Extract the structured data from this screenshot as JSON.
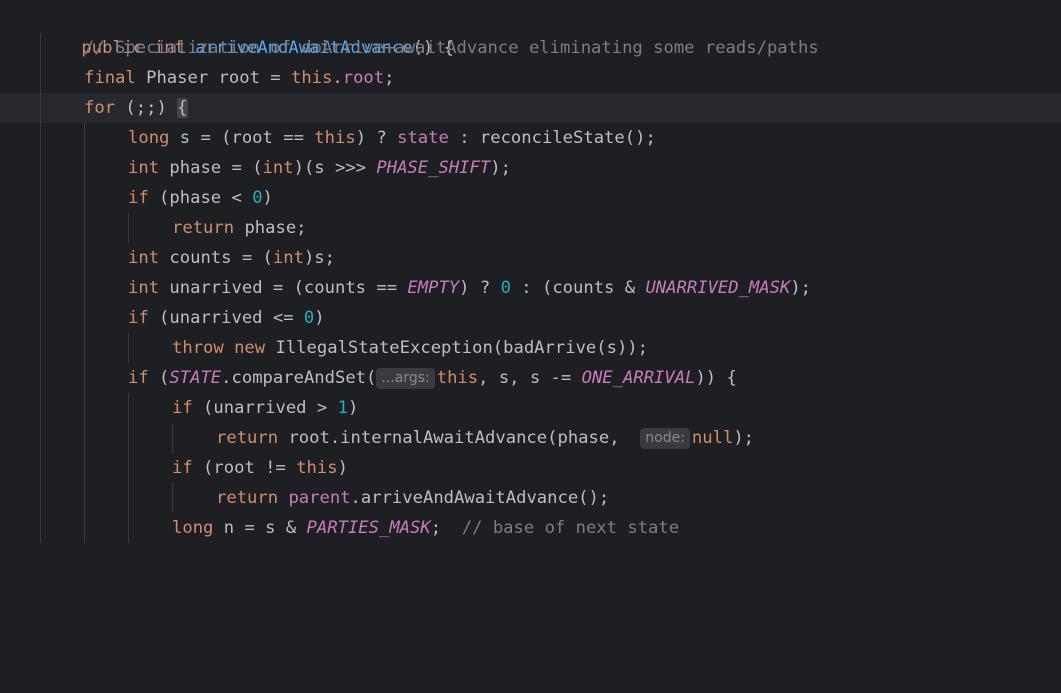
{
  "lines": [
    {
      "tokens": [
        {
          "t": "public int ",
          "c": "kw"
        },
        {
          "t": "arriveAndAwaitAdvance",
          "c": "fn"
        },
        {
          "t": "() {",
          "c": "pl"
        }
      ]
    },
    {
      "tokens": [
        {
          "t": "// Specialization of doArrive+awaitAdvance eliminating some reads/paths",
          "c": "cm"
        }
      ]
    },
    {
      "tokens": [
        {
          "t": "final ",
          "c": "kw"
        },
        {
          "t": "Phaser root = ",
          "c": "pl"
        },
        {
          "t": "this",
          "c": "kw"
        },
        {
          "t": ".",
          "c": "pl"
        },
        {
          "t": "root",
          "c": "fld"
        },
        {
          "t": ";",
          "c": "pl"
        }
      ]
    },
    {
      "tokens": [
        {
          "t": "for ",
          "c": "kw"
        },
        {
          "t": "(;;) ",
          "c": "pl"
        },
        {
          "t": "{",
          "c": "brace-hl"
        }
      ]
    },
    {
      "tokens": [
        {
          "t": "long ",
          "c": "kw"
        },
        {
          "t": "s = (root == ",
          "c": "pl"
        },
        {
          "t": "this",
          "c": "kw"
        },
        {
          "t": ") ? ",
          "c": "pl"
        },
        {
          "t": "state",
          "c": "fld"
        },
        {
          "t": " : reconcileState();",
          "c": "pl"
        }
      ]
    },
    {
      "tokens": [
        {
          "t": "int ",
          "c": "kw"
        },
        {
          "t": "phase = (",
          "c": "pl"
        },
        {
          "t": "int",
          "c": "kw"
        },
        {
          "t": ")(s >>> ",
          "c": "pl"
        },
        {
          "t": "PHASE_SHIFT",
          "c": "cst"
        },
        {
          "t": ");",
          "c": "pl"
        }
      ]
    },
    {
      "tokens": [
        {
          "t": "if ",
          "c": "kw"
        },
        {
          "t": "(phase < ",
          "c": "pl"
        },
        {
          "t": "0",
          "c": "num"
        },
        {
          "t": ")",
          "c": "pl"
        }
      ]
    },
    {
      "tokens": [
        {
          "t": "return ",
          "c": "kw"
        },
        {
          "t": "phase;",
          "c": "pl"
        }
      ]
    },
    {
      "tokens": [
        {
          "t": "int ",
          "c": "kw"
        },
        {
          "t": "counts = (",
          "c": "pl"
        },
        {
          "t": "int",
          "c": "kw"
        },
        {
          "t": ")s;",
          "c": "pl"
        }
      ]
    },
    {
      "tokens": [
        {
          "t": "int ",
          "c": "kw"
        },
        {
          "t": "unarrived = (counts == ",
          "c": "pl"
        },
        {
          "t": "EMPTY",
          "c": "cst"
        },
        {
          "t": ") ? ",
          "c": "pl"
        },
        {
          "t": "0",
          "c": "num"
        },
        {
          "t": " : (counts & ",
          "c": "pl"
        },
        {
          "t": "UNARRIVED_MASK",
          "c": "cst"
        },
        {
          "t": ");",
          "c": "pl"
        }
      ]
    },
    {
      "tokens": [
        {
          "t": "if ",
          "c": "kw"
        },
        {
          "t": "(unarrived <= ",
          "c": "pl"
        },
        {
          "t": "0",
          "c": "num"
        },
        {
          "t": ")",
          "c": "pl"
        }
      ]
    },
    {
      "tokens": [
        {
          "t": "throw new ",
          "c": "kw"
        },
        {
          "t": "IllegalStateException(badArrive(s));",
          "c": "pl"
        }
      ]
    },
    {
      "tokens": [
        {
          "t": "if ",
          "c": "kw"
        },
        {
          "t": "(",
          "c": "pl"
        },
        {
          "t": "STATE",
          "c": "cst"
        },
        {
          "t": ".compareAndSet(",
          "c": "pl"
        },
        {
          "t": "...args:",
          "c": "hint"
        },
        {
          "t": "this",
          "c": "kw"
        },
        {
          "t": ", s, s -= ",
          "c": "pl"
        },
        {
          "t": "ONE_ARRIVAL",
          "c": "cst"
        },
        {
          "t": ")) {",
          "c": "pl"
        }
      ]
    },
    {
      "tokens": [
        {
          "t": "if ",
          "c": "kw"
        },
        {
          "t": "(unarrived > ",
          "c": "pl"
        },
        {
          "t": "1",
          "c": "num"
        },
        {
          "t": ")",
          "c": "pl"
        }
      ]
    },
    {
      "tokens": [
        {
          "t": "return ",
          "c": "kw"
        },
        {
          "t": "root.internalAwaitAdvance(phase,  ",
          "c": "pl"
        },
        {
          "t": "node:",
          "c": "hint"
        },
        {
          "t": "null",
          "c": "kw"
        },
        {
          "t": ");",
          "c": "pl"
        }
      ]
    },
    {
      "tokens": [
        {
          "t": "if ",
          "c": "kw"
        },
        {
          "t": "(root != ",
          "c": "pl"
        },
        {
          "t": "this",
          "c": "kw"
        },
        {
          "t": ")",
          "c": "pl"
        }
      ]
    },
    {
      "tokens": [
        {
          "t": "return ",
          "c": "kw"
        },
        {
          "t": "parent",
          "c": "fld"
        },
        {
          "t": ".arriveAndAwaitAdvance();",
          "c": "pl"
        }
      ]
    },
    {
      "tokens": [
        {
          "t": "long ",
          "c": "kw"
        },
        {
          "t": "n = s & ",
          "c": "pl"
        },
        {
          "t": "PARTIES_MASK",
          "c": "cst"
        },
        {
          "t": ";  ",
          "c": "pl"
        },
        {
          "t": "// base of next state",
          "c": "cm"
        }
      ]
    }
  ],
  "colors": {
    "background": "#1e1f22",
    "current_line": "#26282e",
    "keyword": "#cf8e6d",
    "function": "#56a8f5",
    "comment": "#7a7e85",
    "number": "#2aacb8",
    "field": "#c77dbb",
    "text": "#bcbec4"
  }
}
